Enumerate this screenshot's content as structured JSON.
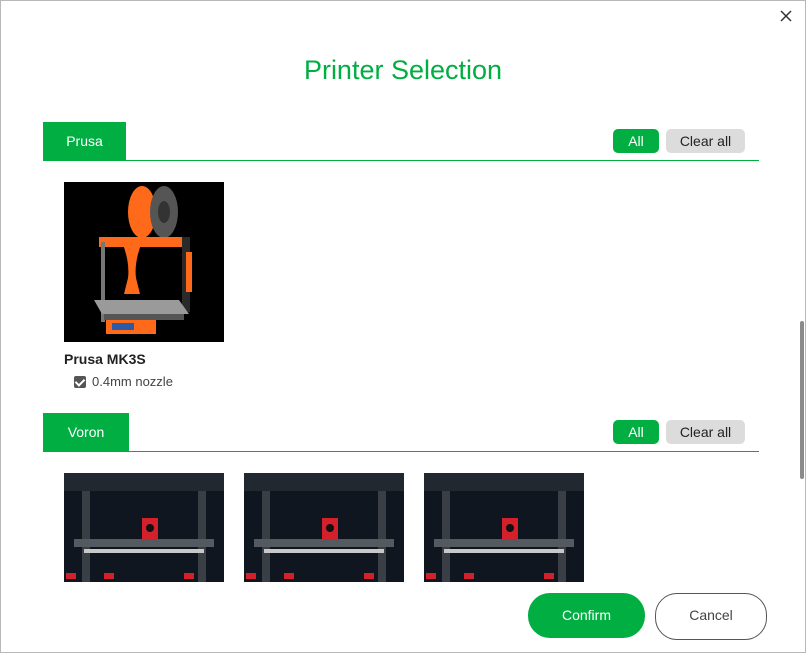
{
  "dialog": {
    "title": "Printer Selection",
    "close_icon": "close-icon"
  },
  "sections": [
    {
      "vendor": "Prusa",
      "all_label": "All",
      "clear_label": "Clear all",
      "printers": [
        {
          "name": "Prusa MK3S",
          "nozzles": [
            {
              "label": "0.4mm nozzle",
              "checked": true
            }
          ]
        }
      ]
    },
    {
      "vendor": "Voron",
      "all_label": "All",
      "clear_label": "Clear all",
      "printers": [
        {
          "name": ""
        },
        {
          "name": ""
        },
        {
          "name": ""
        }
      ]
    }
  ],
  "footer": {
    "confirm_label": "Confirm",
    "cancel_label": "Cancel"
  },
  "colors": {
    "accent": "#00ae42",
    "secondary_button": "#dcdcdc"
  }
}
